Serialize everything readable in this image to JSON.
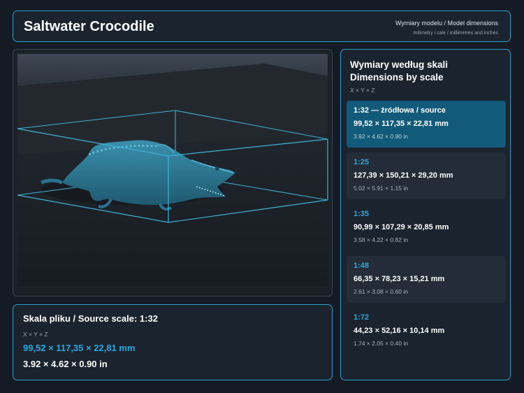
{
  "header": {
    "title": "Saltwater Crocodile",
    "meta_main": "Wymiary modelu / Model dimensions",
    "meta_sub": "milimetry i cale / millimetres and inches"
  },
  "source": {
    "title": "Skala pliku / Source scale: 1:32",
    "axes": "X × Y × Z",
    "mm": "99,52 × 117,35 × 22,81 mm",
    "inches": "3.92 × 4.62 × 0.90 in"
  },
  "scales": {
    "title": "Wymiary według skali Dimensions by scale",
    "axes": "X × Y × Z",
    "items": [
      {
        "label": "1:32  —  źródłowa / source",
        "mm": "99,52 × 117,35 × 22,81 mm",
        "inches": "3.92 × 4.62 × 0.90 in",
        "active": true
      },
      {
        "label": "1:25",
        "mm": "127,39 × 150,21 × 29,20 mm",
        "inches": "5.02 × 5.91 × 1.15 in",
        "active": false
      },
      {
        "label": "1:35",
        "mm": "90,99 × 107,29 × 20,85 mm",
        "inches": "3.58 × 4.22 × 0.82 in",
        "active": false
      },
      {
        "label": "1:48",
        "mm": "66,35 × 78,23 × 15,21 mm",
        "inches": "2.61 × 3.08 × 0.60 in",
        "active": false
      },
      {
        "label": "1:72",
        "mm": "44,23 × 52,16 × 10,14 mm",
        "inches": "1.74 × 2.05 × 0.40 in",
        "active": false
      }
    ]
  },
  "colors": {
    "accent": "#2aa8e0",
    "border": "#2a9fd0",
    "active_card": "#125a79",
    "model": "#2e7d99"
  }
}
